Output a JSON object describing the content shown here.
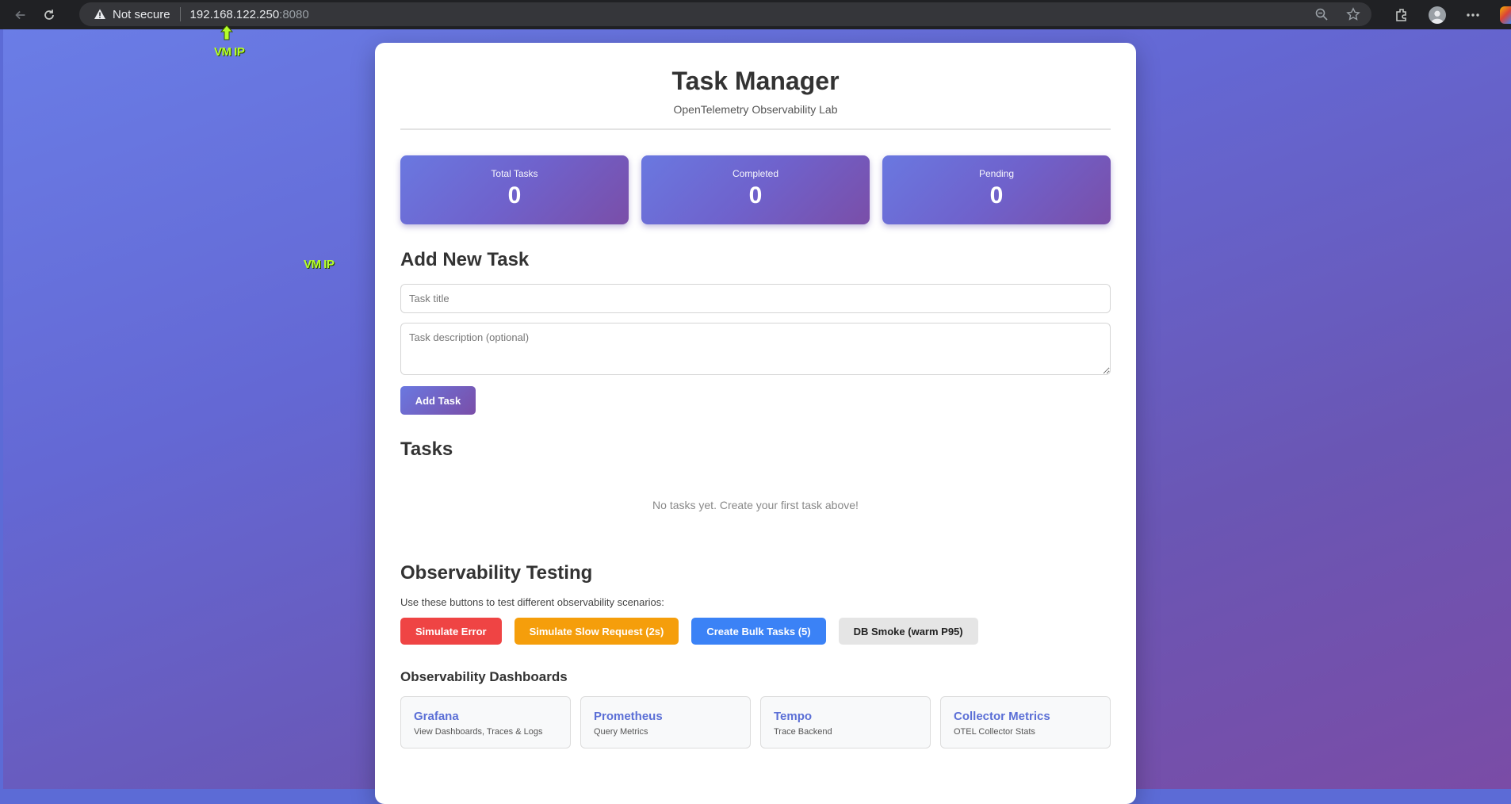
{
  "browser": {
    "security_label": "Not secure",
    "url_host": "192.168.122.250",
    "url_port": ":8080"
  },
  "annotations": {
    "top_label": "VM IP",
    "side_label": "VM IP",
    "color": "#b5ff2a"
  },
  "header": {
    "title": "Task Manager",
    "subtitle": "OpenTelemetry Observability Lab"
  },
  "stats": [
    {
      "label": "Total Tasks",
      "value": "0"
    },
    {
      "label": "Completed",
      "value": "0"
    },
    {
      "label": "Pending",
      "value": "0"
    }
  ],
  "add_task": {
    "heading": "Add New Task",
    "title_placeholder": "Task title",
    "description_placeholder": "Task description (optional)",
    "button_label": "Add Task"
  },
  "tasks": {
    "heading": "Tasks",
    "empty_message": "No tasks yet. Create your first task above!"
  },
  "observability": {
    "heading": "Observability Testing",
    "description": "Use these buttons to test different observability scenarios:",
    "buttons": [
      {
        "label": "Simulate Error",
        "color": "#ef4444"
      },
      {
        "label": "Simulate Slow Request (2s)",
        "color": "#f59e0b"
      },
      {
        "label": "Create Bulk Tasks (5)",
        "color": "#3b82f6"
      },
      {
        "label": "DB Smoke (warm P95)",
        "color": "#e5e5e5"
      }
    ]
  },
  "dashboards": {
    "heading": "Observability Dashboards",
    "items": [
      {
        "name": "Grafana",
        "description": "View Dashboards, Traces & Logs"
      },
      {
        "name": "Prometheus",
        "description": "Query Metrics"
      },
      {
        "name": "Tempo",
        "description": "Trace Backend"
      },
      {
        "name": "Collector Metrics",
        "description": "OTEL Collector Stats"
      }
    ]
  }
}
